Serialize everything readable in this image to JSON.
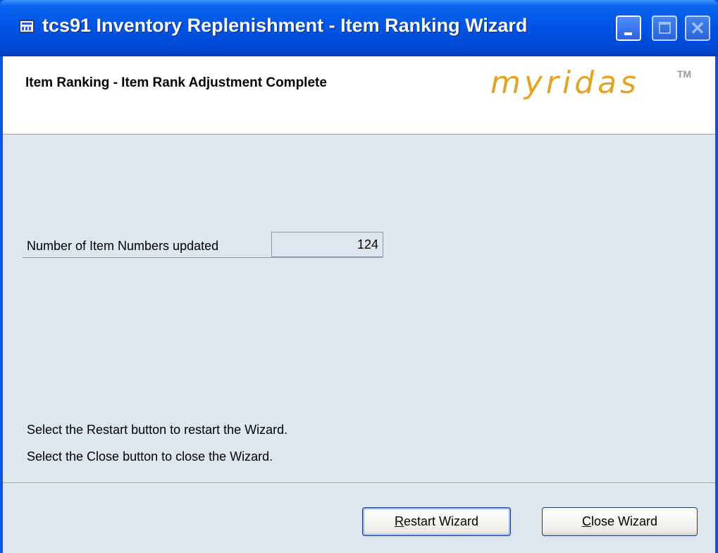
{
  "window": {
    "title": "tcs91 Inventory Replenishment - Item Ranking Wizard",
    "controls": {
      "minimize_icon": "minimize-icon",
      "maximize_icon": "maximize-icon",
      "close_icon": "close-icon"
    }
  },
  "header": {
    "title": "Item Ranking - Item Rank Adjustment Complete",
    "logo_text": "myridas",
    "logo_mark": "TM",
    "logo_color": "#e6a323"
  },
  "result": {
    "label": "Number of Item Numbers updated",
    "value": "124"
  },
  "instructions": {
    "line1": "Select the Restart button to restart the Wizard.",
    "line2": "Select the Close button to close the Wizard."
  },
  "buttons": {
    "restart": {
      "accel": "R",
      "rest": "estart Wizard"
    },
    "close": {
      "accel": "C",
      "rest": "lose Wizard"
    }
  },
  "colors": {
    "titlebar": "#0055e5",
    "client_background": "#dee6ef"
  }
}
